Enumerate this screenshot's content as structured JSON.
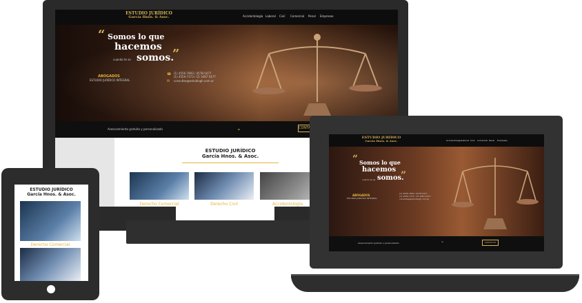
{
  "brand": {
    "line1": "ESTUDIO JURÍDICO",
    "line2": "García Hnos. & Asoc."
  },
  "nav": [
    "Accidentología",
    "Laboral",
    "Civil",
    "Comercial",
    "Penal",
    "Empresas"
  ],
  "hero": {
    "quote_open": "“",
    "line1": "Somos lo que",
    "line2": "hacemos",
    "line2_suffix": "...",
    "line3_prefix": "cuando te se",
    "line3": "somos.",
    "quote_close": "”",
    "title": "ABOGADOS",
    "subtitle": "ESTUDIO JURÍDICO INTEGRAL",
    "phone1": "(1) 4556-7893 / 4578-5477",
    "phone2": "(1) 4559-7373 / 15 1087-5477",
    "email": "consultas@estudiogh.com.ar"
  },
  "bar": {
    "text": "Asesoramiento gratuito y personalizado",
    "chevron": "⌄",
    "button": "CONTACTO"
  },
  "section": {
    "title1": "ESTUDIO JURÍDICO",
    "title2": "García Hnos. & Asoc."
  },
  "cards": [
    "Derecho Comercial",
    "Derecho Civil",
    "Accidentología"
  ],
  "tablet": {
    "card_label": "Derecho Comercial"
  },
  "laptop": {
    "bar_text": "Asesoramiento gratuito y personalizado",
    "button": "CONTACTO"
  },
  "colors": {
    "gold": "#e5b33c",
    "dark": "#0d0d0d",
    "frame": "#2c2c2c"
  }
}
